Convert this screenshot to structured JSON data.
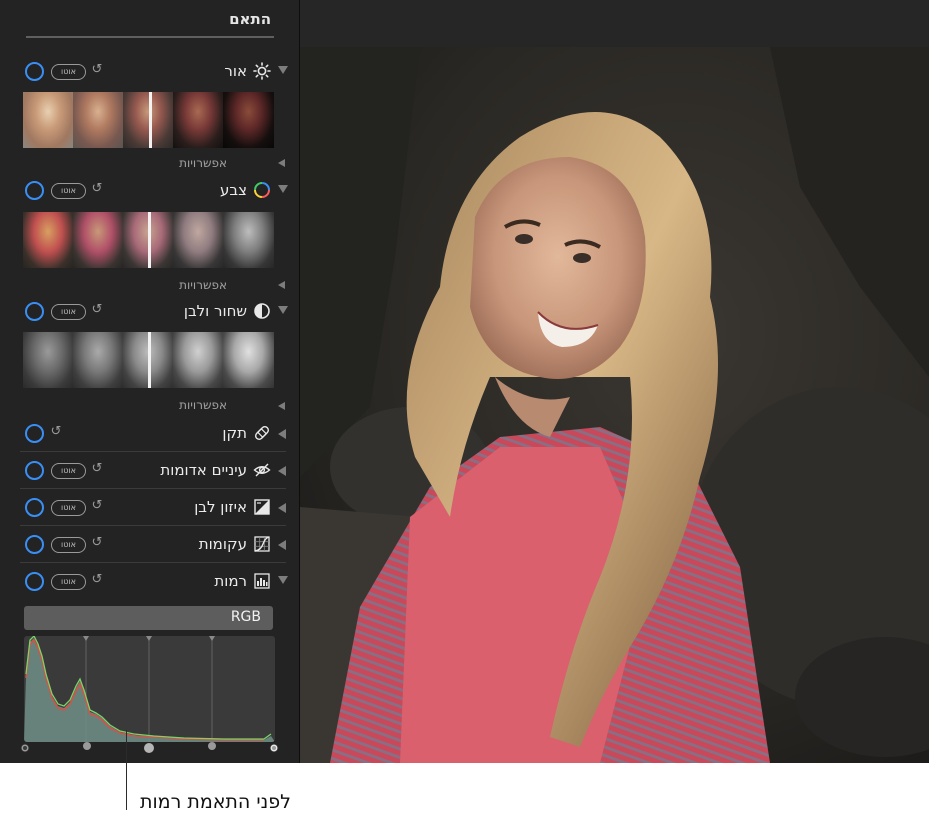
{
  "panel": {
    "title": "התאם",
    "sections": {
      "light": {
        "label": "אור",
        "auto": "אוטו",
        "icon": "sun-icon",
        "expanded": true
      },
      "color": {
        "label": "צבע",
        "auto": "אוטו",
        "icon": "color-wheel-icon",
        "expanded": true
      },
      "bw": {
        "label": "שחור ולבן",
        "auto": "אוטו",
        "icon": "half-circle-icon",
        "expanded": true
      },
      "retouch": {
        "label": "תקן",
        "icon": "bandage-icon",
        "expanded": false
      },
      "redeye": {
        "label": "עיניים אדומות",
        "auto": "אוטו",
        "icon": "eye-slash-icon",
        "expanded": false
      },
      "white_balance": {
        "label": "איזון לבן",
        "auto": "אוטו",
        "icon": "white-balance-icon",
        "expanded": false
      },
      "curves": {
        "label": "עקומות",
        "auto": "אוטו",
        "icon": "curves-icon",
        "expanded": false
      },
      "levels": {
        "label": "רמות",
        "auto": "אוטו",
        "icon": "levels-icon",
        "expanded": true
      }
    },
    "options_label": "אפשרויות",
    "levels_channel": "RGB"
  },
  "callout": {
    "text": "לפני התאמת רמות"
  },
  "colors": {
    "accent": "#3a8ff5",
    "panel_bg": "#232323",
    "text": "#ebebeb"
  }
}
